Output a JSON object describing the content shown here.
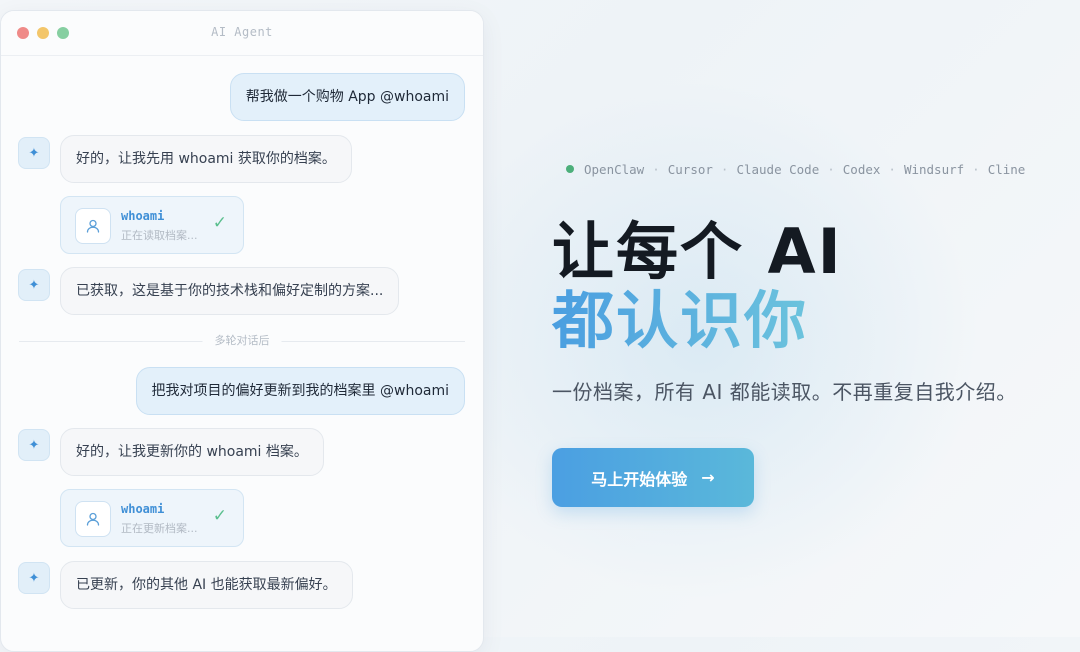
{
  "window": {
    "title": "AI Agent"
  },
  "chat": {
    "user_msg_1": "帮我做一个购物 App @whoami",
    "bot_msg_1": "好的，让我先用 whoami 获取你的档案。",
    "tool_1": {
      "name": "whoami",
      "status": "正在读取档案...",
      "check_icon": "check-icon"
    },
    "bot_msg_2": "已获取，这是基于你的技术栈和偏好定制的方案...",
    "divider": "多轮对话后",
    "user_msg_2": "把我对项目的偏好更新到我的档案里 @whoami",
    "bot_msg_3": "好的，让我更新你的 whoami 档案。",
    "tool_2": {
      "name": "whoami",
      "status": "正在更新档案...",
      "check_icon": "check-icon"
    },
    "bot_msg_4": "已更新，你的其他 AI 也能获取最新偏好。",
    "bot_avatar_icon": "sparkle-icon",
    "tool_icon": "user-icon"
  },
  "hero": {
    "tools": [
      "OpenClaw",
      "Cursor",
      "Claude Code",
      "Codex",
      "Windsurf",
      "Cline"
    ],
    "separator": "·",
    "headline_1": "让每个 AI",
    "headline_2": "都认识你",
    "subtitle": "一份档案，所有 AI 都能读取。不再重复自我介绍。",
    "cta_label": "马上开始体验",
    "cta_arrow": "→"
  },
  "colors": {
    "accent": "#4a9ee0",
    "accent_light": "#6cc3dd",
    "success": "#5bbf8e",
    "status_dot": "#4caf7a"
  }
}
